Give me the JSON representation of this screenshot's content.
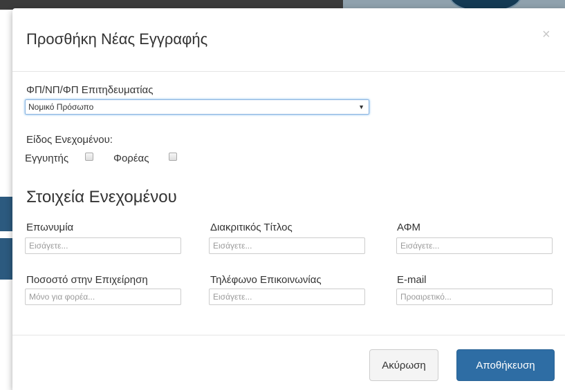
{
  "modal": {
    "title": "Προσθήκη Νέας Εγγραφής",
    "close_symbol": "×"
  },
  "person_type": {
    "label": "ΦΠ/ΝΠ/ΦΠ Επιτηδευματίας",
    "selected": "Νομικό Πρόσωπο",
    "caret": "▼"
  },
  "involved_type": {
    "label": "Είδος Ενεχομένου:",
    "options": [
      {
        "label": "Εγγυητής",
        "checked": false
      },
      {
        "label": "Φορέας",
        "checked": false
      }
    ]
  },
  "details": {
    "title": "Στοιχεία Ενεχομένου",
    "fields": [
      {
        "label": "Επωνυμία",
        "placeholder": "Εισάγετε..."
      },
      {
        "label": "Διακριτικός Τίτλος",
        "placeholder": "Εισάγετε..."
      },
      {
        "label": "ΑΦΜ",
        "placeholder": "Εισάγετε..."
      },
      {
        "label": "Ποσοστό στην Επιχείρηση",
        "placeholder": "Μόνο για φορέα..."
      },
      {
        "label": "Τηλέφωνο Επικοινωνίας",
        "placeholder": "Εισάγετε..."
      },
      {
        "label": "E-mail",
        "placeholder": "Προαιρετικό..."
      }
    ]
  },
  "footer": {
    "cancel_label": "Ακύρωση",
    "save_label": "Αποθήκευση"
  },
  "colors": {
    "primary": "#2e6da4",
    "focus": "#66afe9"
  }
}
